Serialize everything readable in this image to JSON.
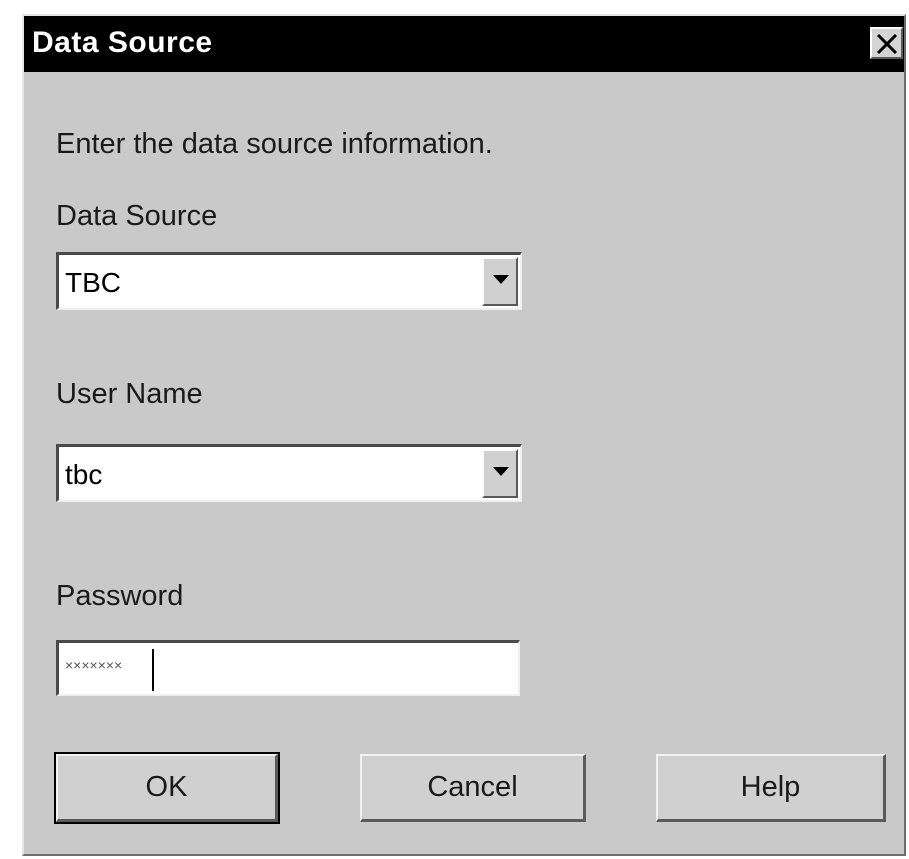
{
  "dialog": {
    "title": "Data Source",
    "instructions": "Enter the data source information.",
    "data_source": {
      "label": "Data Source",
      "value": "TBC"
    },
    "user_name": {
      "label": "User Name",
      "value": "tbc"
    },
    "password": {
      "label": "Password",
      "value": "×××××××"
    },
    "buttons": {
      "ok": "OK",
      "cancel": "Cancel",
      "help": "Help"
    },
    "icons": {
      "close": "close-icon",
      "dropdown": "chevron-down-icon"
    }
  }
}
